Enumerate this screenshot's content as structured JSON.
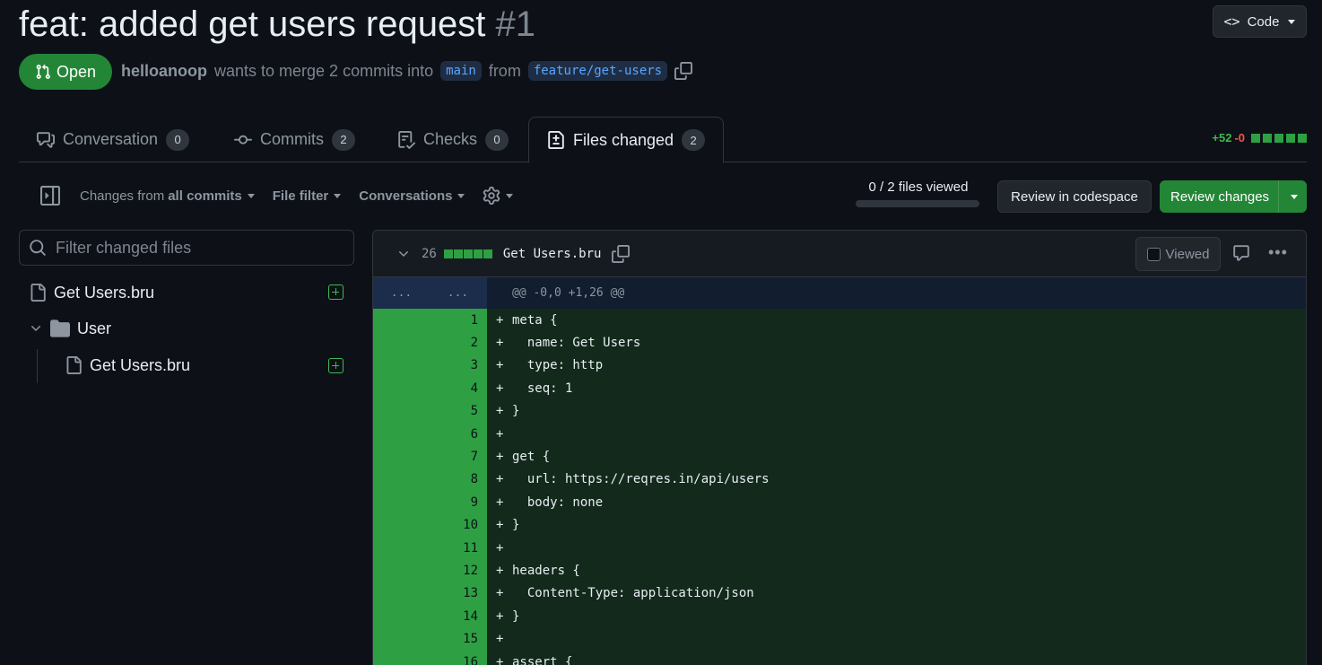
{
  "pr": {
    "title": "feat: added get users request",
    "number": "#1",
    "state": "Open",
    "author": "helloanoop",
    "merge_text": "wants to merge 2 commits into",
    "base_branch": "main",
    "from_text": "from",
    "head_branch": "feature/get-users"
  },
  "header": {
    "code_label": "Code"
  },
  "tabs": [
    {
      "label": "Conversation",
      "count": "0"
    },
    {
      "label": "Commits",
      "count": "2"
    },
    {
      "label": "Checks",
      "count": "0"
    },
    {
      "label": "Files changed",
      "count": "2"
    }
  ],
  "diffstat": {
    "additions": "+52",
    "deletions": "-0"
  },
  "toolbar": {
    "changes_from_prefix": "Changes from",
    "changes_from_value": "all commits",
    "file_filter": "File filter",
    "conversations": "Conversations",
    "files_viewed": "0 / 2 files viewed",
    "files_viewed_fraction": 0,
    "review_codespace": "Review in codespace",
    "review_changes": "Review changes"
  },
  "sidebar": {
    "filter_placeholder": "Filter changed files",
    "tree": [
      {
        "type": "file",
        "name": "Get Users.bru"
      },
      {
        "type": "folder",
        "name": "User"
      },
      {
        "type": "file",
        "name": "Get Users.bru"
      }
    ]
  },
  "file": {
    "changes": "26",
    "name": "Get Users.bru",
    "viewed_label": "Viewed",
    "hunk_gutter": "...",
    "hunk_header": "@@ -0,0 +1,26 @@",
    "lines": [
      {
        "n": "1",
        "text": "meta {"
      },
      {
        "n": "2",
        "text": "  name: Get Users"
      },
      {
        "n": "3",
        "text": "  type: http"
      },
      {
        "n": "4",
        "text": "  seq: 1"
      },
      {
        "n": "5",
        "text": "}"
      },
      {
        "n": "6",
        "text": ""
      },
      {
        "n": "7",
        "text": "get {"
      },
      {
        "n": "8",
        "text": "  url: https://reqres.in/api/users"
      },
      {
        "n": "9",
        "text": "  body: none"
      },
      {
        "n": "10",
        "text": "}"
      },
      {
        "n": "11",
        "text": ""
      },
      {
        "n": "12",
        "text": "headers {"
      },
      {
        "n": "13",
        "text": "  Content-Type: application/json"
      },
      {
        "n": "14",
        "text": "}"
      },
      {
        "n": "15",
        "text": ""
      },
      {
        "n": "16",
        "text": "assert {"
      }
    ]
  }
}
